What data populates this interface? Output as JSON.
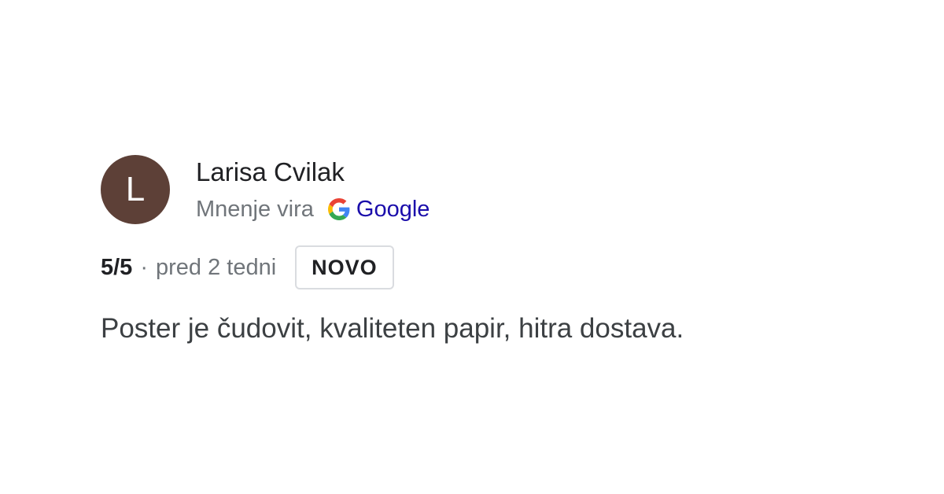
{
  "review": {
    "avatar_letter": "L",
    "avatar_color": "#5d4037",
    "author_name": "Larisa Cvilak",
    "source_label": "Mnenje vira",
    "source_icon": "google-g-icon",
    "source_name": "Google",
    "rating": "5/5",
    "separator": "·",
    "time_ago": "pred 2 tedni",
    "badge": "NOVO",
    "text": "Poster je čudovit, kvaliteten papir, hitra dostava."
  }
}
